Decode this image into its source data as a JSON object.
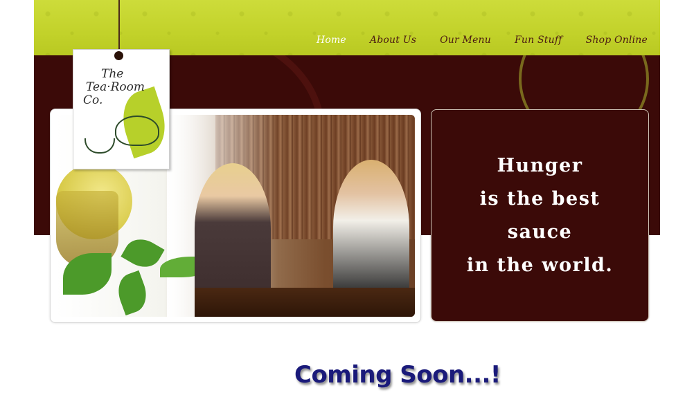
{
  "nav": {
    "items": [
      {
        "label": "Home",
        "active": true
      },
      {
        "label": "About Us"
      },
      {
        "label": "Our Menu"
      },
      {
        "label": "Fun Stuff"
      },
      {
        "label": "Shop Online"
      }
    ]
  },
  "logo": {
    "line1": "The",
    "line2": "Tea·Room",
    "line3": "Co."
  },
  "quote": {
    "lines": [
      "Hunger",
      "is the best",
      "sauce",
      "in the world."
    ]
  },
  "footer": {
    "coming_soon": "Coming Soon...!"
  },
  "colors": {
    "lime": "#c2d22a",
    "maroon": "#3b0a08",
    "navy": "#1a1a7a"
  }
}
